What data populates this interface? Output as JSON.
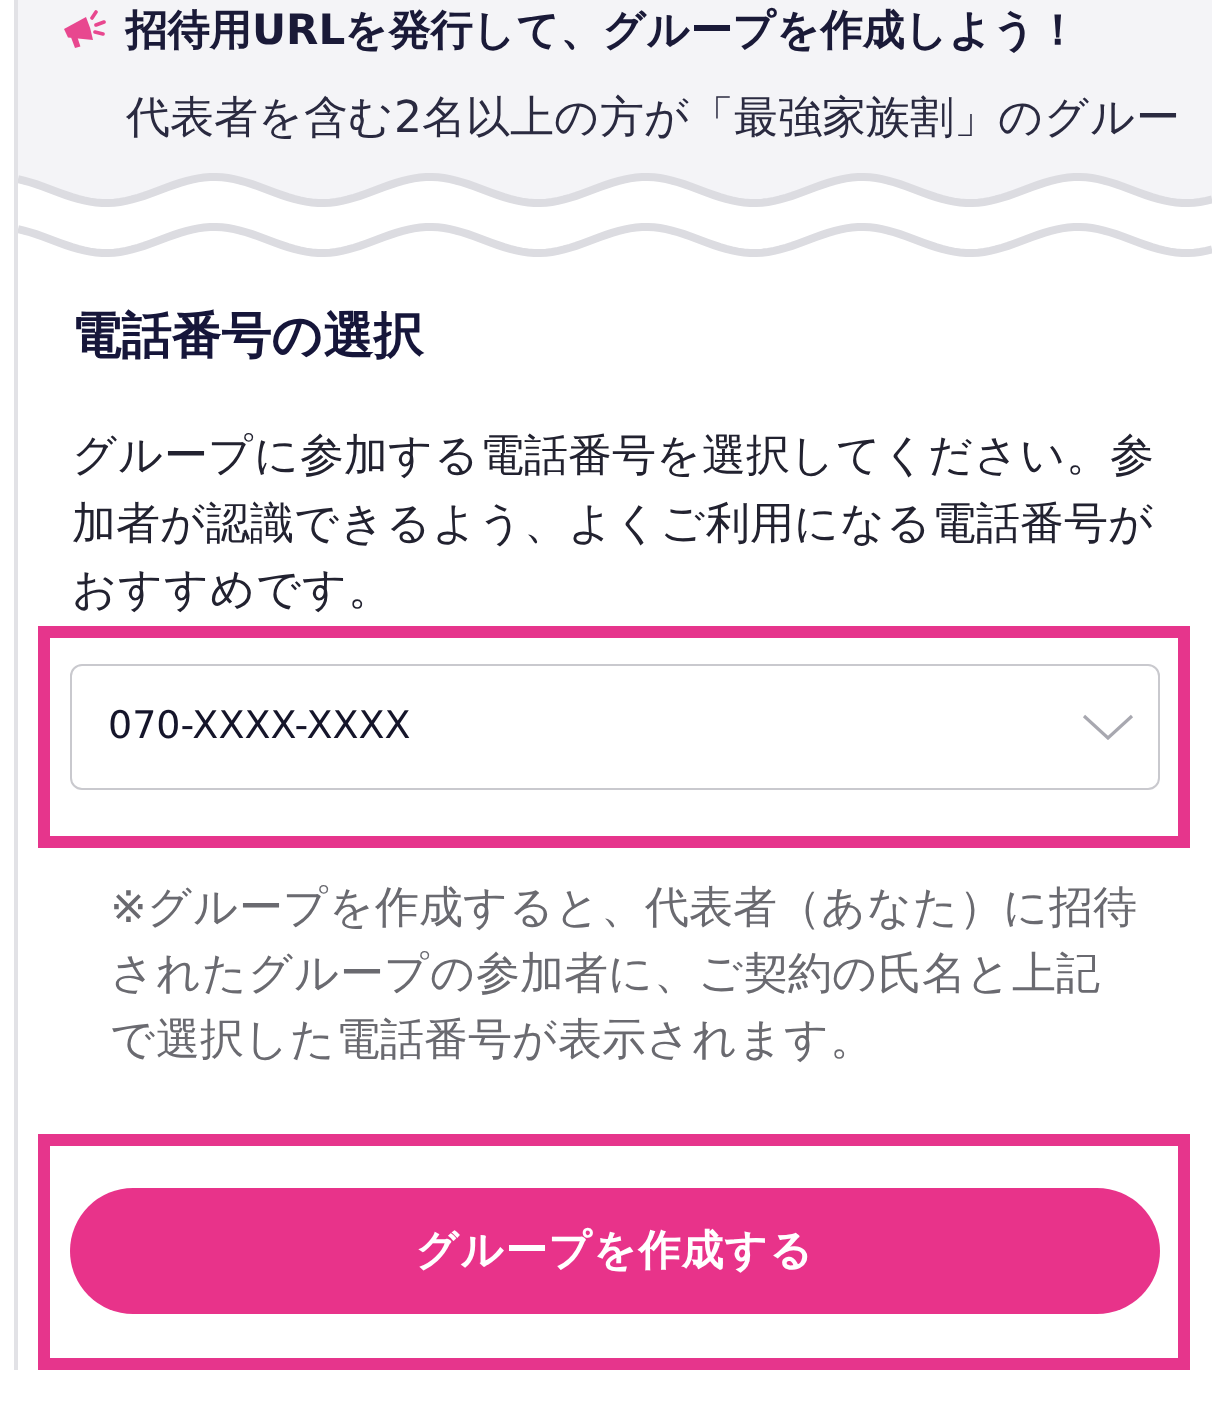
{
  "intro": {
    "title": "招待用URLを発行して、グループを作成しよう！",
    "text": "代表者を含む2名以上の方が「最強家族割」のグルー"
  },
  "section": {
    "title": "電話番号の選択",
    "description": "グループに参加する電話番号を選択してください。参加者が認識できるよう、よくご利用になる電話番号がおすすめです。"
  },
  "phone_select": {
    "value": "070-XXXX-XXXX",
    "highlighted": true
  },
  "note": "※グループを作成すると、代表者（あなた）に招待されたグループの参加者に、ご契約の氏名と上記で選択した電話番号が表示されます。",
  "create_button": {
    "label": "グループを作成する",
    "highlighted": true
  }
}
